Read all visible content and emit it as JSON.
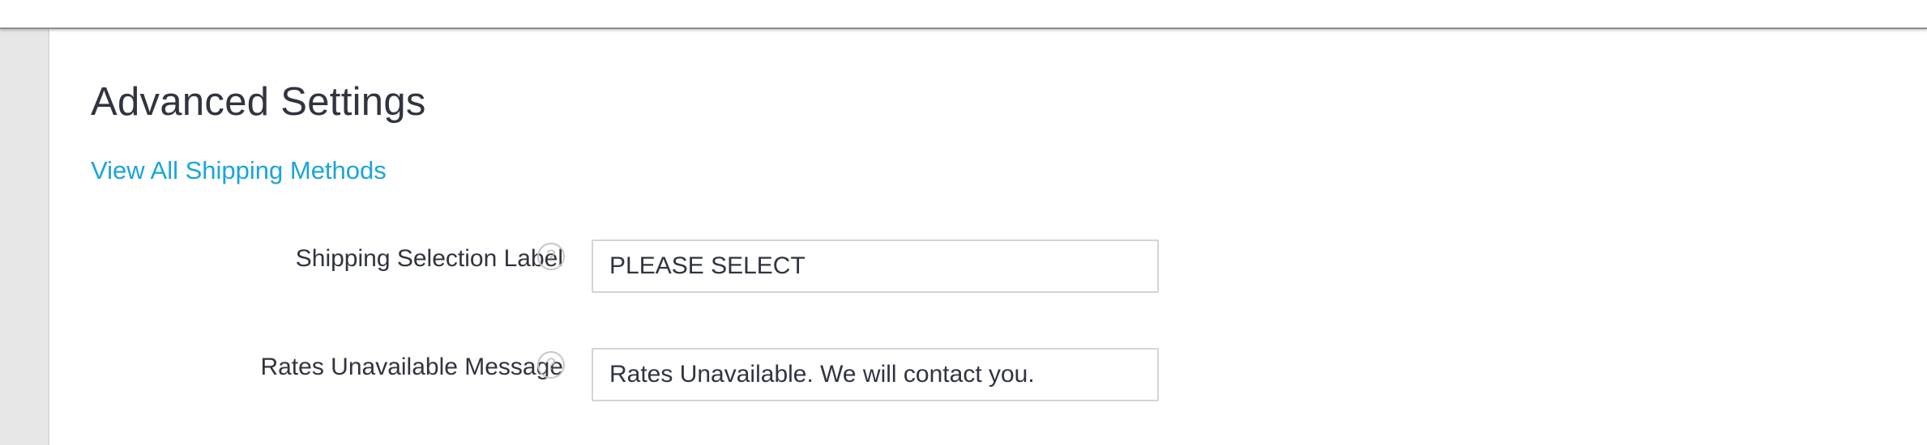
{
  "page": {
    "title": "Advanced Settings",
    "view_all_link": "View All Shipping Methods"
  },
  "fields": {
    "shipping_selection_label": {
      "label": "Shipping Selection Label",
      "value": "PLEASE SELECT",
      "help_icon": "question-circle-icon"
    },
    "rates_unavailable_message": {
      "label": "Rates Unavailable Message",
      "value": "Rates Unavailable. We will contact you.",
      "help_icon": "question-circle-icon"
    }
  },
  "colors": {
    "link": "#1ba4dc",
    "text": "#313440",
    "rail": "#e7e7e7"
  }
}
